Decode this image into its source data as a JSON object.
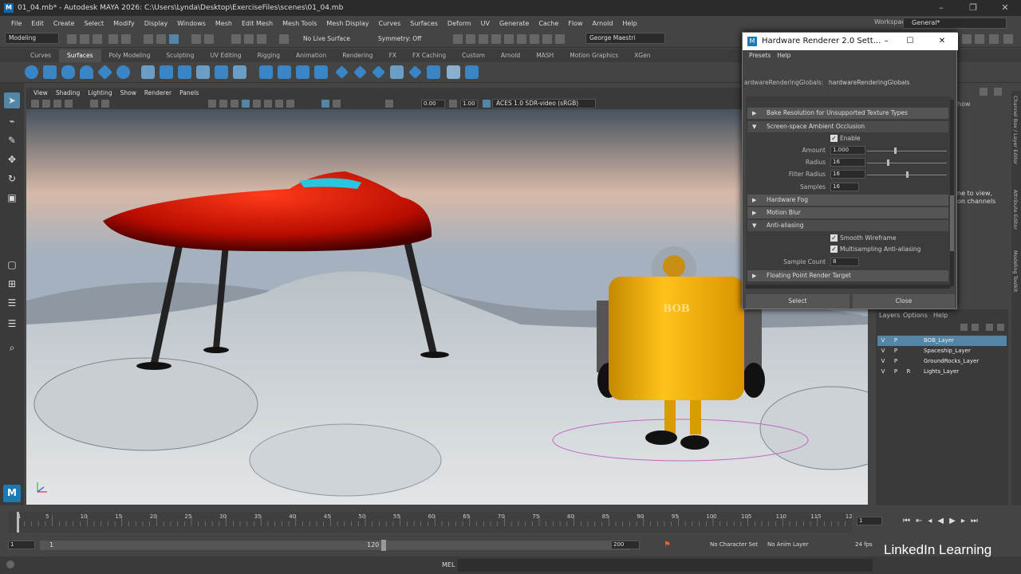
{
  "window": {
    "title": "01_04.mb* - Autodesk MAYA 2026: C:\\Users\\Lynda\\Desktop\\ExerciseFiles\\scenes\\01_04.mb",
    "app_icon": "M"
  },
  "menubar": {
    "items": [
      "File",
      "Edit",
      "Create",
      "Select",
      "Modify",
      "Display",
      "Windows",
      "Mesh",
      "Edit Mesh",
      "Mesh Tools",
      "Mesh Display",
      "Curves",
      "Surfaces",
      "Deform",
      "UV",
      "Generate",
      "Cache",
      "Flow",
      "Arnold",
      "Help"
    ],
    "workspace_label": "Workspace:",
    "workspace_value": "General*"
  },
  "statusline": {
    "mode": "Modeling",
    "live_surface": "No Live Surface",
    "symmetry": "Symmetry: Off",
    "user": "George Maestri"
  },
  "shelf": {
    "tabs": [
      "Curves",
      "Surfaces",
      "Poly Modeling",
      "Sculpting",
      "UV Editing",
      "Rigging",
      "Animation",
      "Rendering",
      "FX",
      "FX Caching",
      "Custom",
      "Arnold",
      "MASH",
      "Motion Graphics",
      "XGen"
    ],
    "active": "Surfaces"
  },
  "panel": {
    "menus": [
      "View",
      "Shading",
      "Lighting",
      "Show",
      "Renderer",
      "Panels"
    ],
    "val1": "0.00",
    "val2": "1.00",
    "colorspace": "ACES 1.0 SDR-video (sRGB)"
  },
  "viewport": {
    "robot_text": "BOB"
  },
  "dialog": {
    "title": "Hardware Renderer 2.0 Sett...",
    "menus": [
      "Presets",
      "Help"
    ],
    "node_label": "ardwareRenderingGlobals:",
    "node_value": "hardwareRenderingGlobals",
    "sections": {
      "bake": "Bake Resolution for Unsupported Texture Types",
      "ssao": "Screen-space Ambient Occlusion",
      "fog": "Hardware Fog",
      "blur": "Motion Blur",
      "aa": "Anti-aliasing",
      "fprt": "Floating Point Render Target"
    },
    "ssao": {
      "enable": "Enable",
      "amount_label": "Amount",
      "amount": "1.000",
      "radius_label": "Radius",
      "radius": "16",
      "filter_label": "Filter Radius",
      "filter": "16",
      "samples_label": "Samples",
      "samples": "16"
    },
    "aa": {
      "smooth": "Smooth Wireframe",
      "multi": "Multisampling Anti-aliasing",
      "count_label": "Sample Count",
      "count": "8"
    },
    "select": "Select",
    "close": "Close"
  },
  "rightpanel": {
    "text1": "how",
    "text2": "ne to view,",
    "text3": "on channels",
    "side_tabs": [
      "Channel Box / Layer Editor",
      "Attribute Editor",
      "Modeling Toolkit"
    ]
  },
  "layers": {
    "menus": [
      "Layers",
      "Options",
      "Help"
    ],
    "rows": [
      {
        "v": "V",
        "p": "P",
        "r": "",
        "name": "BOB_Layer"
      },
      {
        "v": "V",
        "p": "P",
        "r": "",
        "name": "Spaceship_Layer"
      },
      {
        "v": "V",
        "p": "P",
        "r": "",
        "name": "GroundRocks_Layer"
      },
      {
        "v": "V",
        "p": "P",
        "r": "R",
        "name": "Lights_Layer"
      }
    ]
  },
  "timeline": {
    "ticks": [
      "1",
      "5",
      "10",
      "15",
      "20",
      "25",
      "30",
      "35",
      "40",
      "45",
      "50",
      "55",
      "60",
      "65",
      "70",
      "75",
      "80",
      "85",
      "90",
      "95",
      "100",
      "105",
      "110",
      "115",
      "12"
    ],
    "current": "1"
  },
  "range": {
    "start": "1",
    "start2": "1",
    "end2": "120",
    "end": "200",
    "character": "No Character Set",
    "anim_layer": "No Anim Layer",
    "fps": "24 fps"
  },
  "cmd": {
    "lang": "MEL"
  },
  "watermark": "LinkedIn Learning"
}
